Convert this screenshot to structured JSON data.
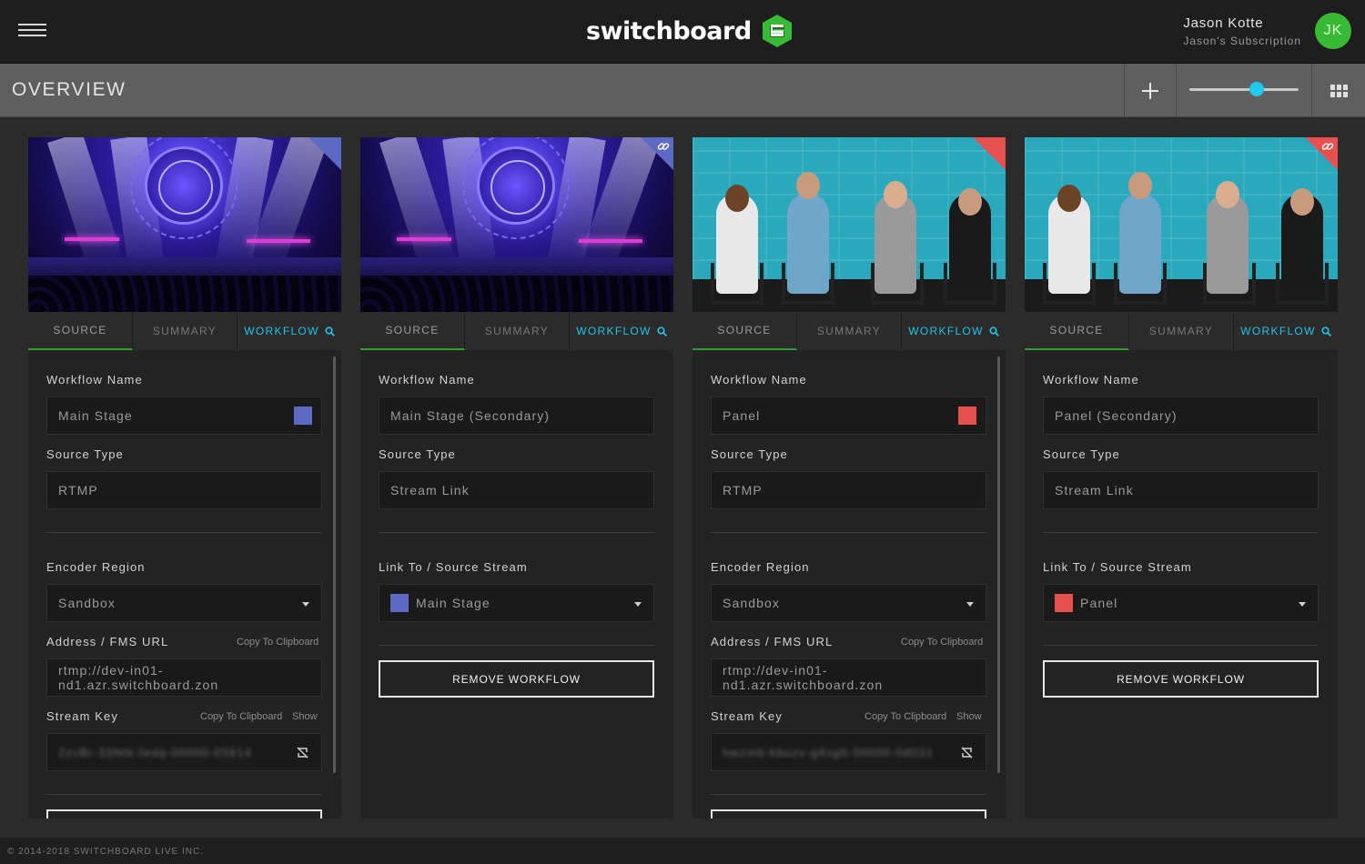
{
  "app": {
    "brand": "switchboard",
    "brand_color": "#37bb34",
    "accent_color": "#1fc9ef"
  },
  "user": {
    "name": "Jason Kotte",
    "subscription": "Jason's Subscription",
    "initials": "JK"
  },
  "header": {
    "title": "OVERVIEW",
    "zoom_level": 0.62
  },
  "tabs": {
    "source": "SOURCE",
    "summary": "SUMMARY",
    "workflow": "WORKFLOW"
  },
  "labels": {
    "workflow_name": "Workflow Name",
    "source_type": "Source Type",
    "encoder_region": "Encoder Region",
    "address": "Address / FMS URL",
    "stream_key": "Stream Key",
    "link_to": "Link To / Source Stream",
    "copy": "Copy To Clipboard",
    "show": "Show",
    "remove": "REMOVE WORKFLOW"
  },
  "cards": [
    {
      "workflow_name": "Main Stage",
      "color": "#5d6ac4",
      "source_type": "RTMP",
      "encoder_region": "Sandbox",
      "address": "rtmp://dev-in01-nd1.azr.switchboard.zon",
      "stream_key": "2zvBr-33Ntk-fedq-00000-05914",
      "scene": "stage",
      "corner_color": "#5d6ac4"
    },
    {
      "workflow_name": "Main Stage (Secondary)",
      "source_type": "Stream Link",
      "link_to": "Main Stage",
      "link_color": "#5d6ac4",
      "scene": "stage",
      "corner_color": "#5d6ac4"
    },
    {
      "workflow_name": "Panel",
      "color": "#e8504f",
      "source_type": "RTMP",
      "encoder_region": "Sandbox",
      "address": "rtmp://dev-in01-nd1.azr.switchboard.zon",
      "stream_key": "hwzmb-kbuzv-g4sgb-00000-0d031",
      "scene": "panel",
      "corner_color": "#e8504f"
    },
    {
      "workflow_name": "Panel (Secondary)",
      "source_type": "Stream Link",
      "link_to": "Panel",
      "link_color": "#e8504f",
      "scene": "panel",
      "corner_color": "#e8504f"
    }
  ],
  "footer": {
    "copyright": "© 2014-2018 SWITCHBOARD LIVE INC."
  }
}
